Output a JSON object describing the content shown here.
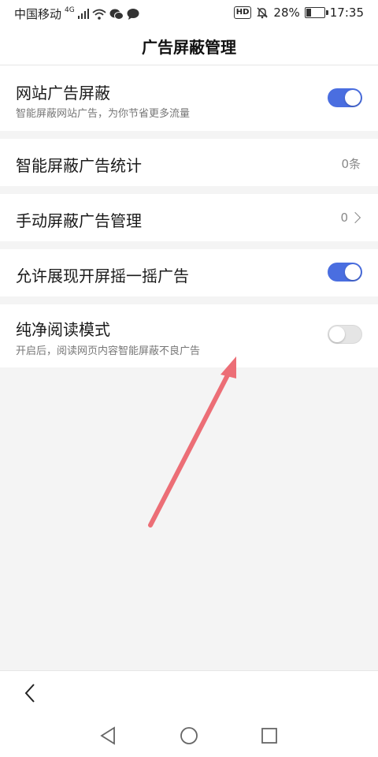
{
  "status_bar": {
    "carrier": "中国移动",
    "network": "4G",
    "hd_badge": "HD",
    "battery_percent": "28%",
    "battery_level": 0.28,
    "time": "17:35",
    "icons": [
      "signal-icon",
      "wifi-icon",
      "wechat-icon",
      "message-icon",
      "mute-bell-icon",
      "battery-icon"
    ]
  },
  "header": {
    "title": "广告屏蔽管理"
  },
  "settings": {
    "web_ad_block": {
      "label": "网站广告屏蔽",
      "description": "智能屏蔽网站广告，为你节省更多流量",
      "enabled": true
    },
    "ad_stats": {
      "label": "智能屏蔽广告统计",
      "value": "0条"
    },
    "manual_block": {
      "label": "手动屏蔽广告管理",
      "value": "0"
    },
    "shake_ads": {
      "label": "允许展现开屏摇一摇广告",
      "enabled": true
    },
    "pure_reading": {
      "label": "纯净阅读模式",
      "description": "开启后，阅读网页内容智能屏蔽不良广告",
      "enabled": false
    }
  },
  "colors": {
    "accent": "#4a6ee0",
    "arrow": "#ec6e76",
    "background": "#f4f4f4"
  },
  "nav": {
    "buttons": [
      "back-icon",
      "home-icon",
      "recents-icon"
    ]
  }
}
